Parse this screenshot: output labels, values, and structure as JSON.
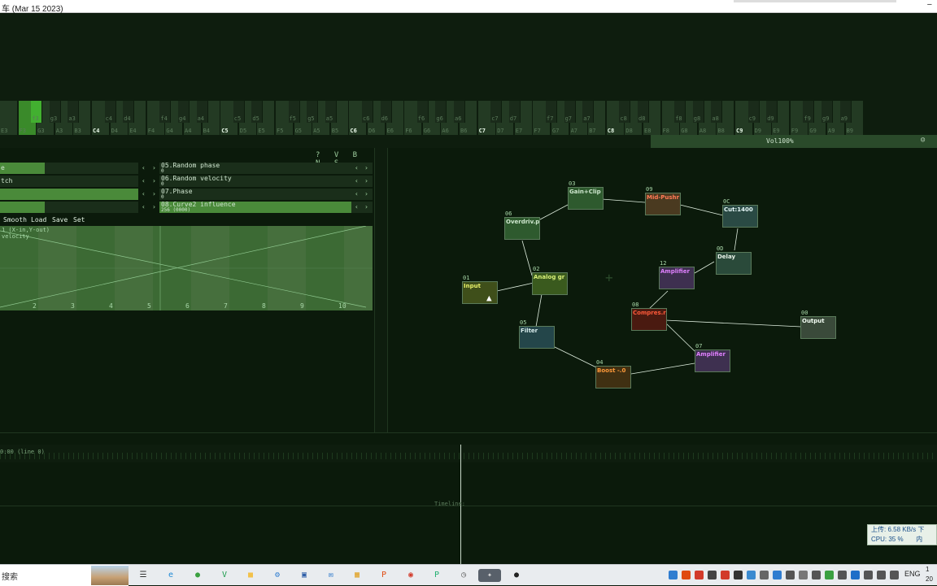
{
  "window": {
    "title": "车 (Mar 15 2023)",
    "close": "−"
  },
  "keyboard": {
    "whites": [
      {
        "label": "E3"
      },
      {
        "label": "F3",
        "hl": true
      },
      {
        "label": "G3"
      },
      {
        "label": "A3"
      },
      {
        "label": "B3"
      },
      {
        "label": "C4",
        "oct": true
      },
      {
        "label": "D4"
      },
      {
        "label": "E4"
      },
      {
        "label": "F4"
      },
      {
        "label": "G4"
      },
      {
        "label": "A4"
      },
      {
        "label": "B4"
      },
      {
        "label": "C5",
        "oct": true
      },
      {
        "label": "D5"
      },
      {
        "label": "E5"
      },
      {
        "label": "F5"
      },
      {
        "label": "G5"
      },
      {
        "label": "A5"
      },
      {
        "label": "B5"
      },
      {
        "label": "C6",
        "oct": true
      },
      {
        "label": "D6"
      },
      {
        "label": "E6"
      },
      {
        "label": "F6"
      },
      {
        "label": "G6"
      },
      {
        "label": "A6"
      },
      {
        "label": "B6"
      },
      {
        "label": "C7",
        "oct": true
      },
      {
        "label": "D7"
      },
      {
        "label": "E7"
      },
      {
        "label": "F7"
      },
      {
        "label": "G7"
      },
      {
        "label": "A7"
      },
      {
        "label": "B7"
      },
      {
        "label": "C8",
        "oct": true
      },
      {
        "label": "D8"
      },
      {
        "label": "E8"
      },
      {
        "label": "F8"
      },
      {
        "label": "G8"
      },
      {
        "label": "A8"
      },
      {
        "label": "B8"
      },
      {
        "label": "C9",
        "oct": true
      },
      {
        "label": "D9"
      },
      {
        "label": "E9"
      },
      {
        "label": "F9"
      },
      {
        "label": "G9"
      },
      {
        "label": "A9"
      },
      {
        "label": "B9"
      }
    ],
    "blacks": [
      {
        "label": "f3",
        "hl": true
      },
      {
        "label": "g3"
      },
      {
        "label": "a3"
      },
      {
        "label": "c4"
      },
      {
        "label": "d4"
      },
      {
        "label": "f4"
      },
      {
        "label": "g4"
      },
      {
        "label": "a4"
      },
      {
        "label": "c5"
      },
      {
        "label": "d5"
      },
      {
        "label": "f5"
      },
      {
        "label": "g5"
      },
      {
        "label": "a5"
      },
      {
        "label": "c6"
      },
      {
        "label": "d6"
      },
      {
        "label": "f6"
      },
      {
        "label": "g6"
      },
      {
        "label": "a6"
      },
      {
        "label": "c7"
      },
      {
        "label": "d7"
      },
      {
        "label": "f7"
      },
      {
        "label": "g7"
      },
      {
        "label": "a7"
      },
      {
        "label": "c8"
      },
      {
        "label": "d8"
      },
      {
        "label": "f8"
      },
      {
        "label": "g8"
      },
      {
        "label": "a8"
      },
      {
        "label": "c9"
      },
      {
        "label": "d9"
      },
      {
        "label": "f9"
      },
      {
        "label": "g9"
      },
      {
        "label": "a9"
      }
    ]
  },
  "volume": {
    "label": "Vol100%",
    "icon": "person-icon"
  },
  "panel": {
    "icons": "? V B N S",
    "controls_left": [
      {
        "label": "e",
        "level": 0.12
      },
      {
        "label": "tch",
        "level": 0.0
      },
      {
        "label": "",
        "level": 0.37
      },
      {
        "label": "",
        "level": 0.12
      }
    ],
    "controls_right": [
      {
        "name": "05.Random phase",
        "value": "0"
      },
      {
        "name": "06.Random velocity",
        "value": "0"
      },
      {
        "name": "07.Phase",
        "value": "0"
      },
      {
        "name": "08.Curve2 influence",
        "value": "256 (0000)"
      }
    ],
    "curve_buttons": [
      "Smooth",
      "Load",
      "Save",
      "Set"
    ],
    "graph_label_1": "1 (X-in,Y-out)",
    "graph_label_2": "velocity",
    "ticks": [
      "2",
      "3",
      "4",
      "5",
      "6",
      "7",
      "8",
      "9",
      "10"
    ]
  },
  "modules": [
    {
      "id": "01",
      "name": "Input",
      "bg": "#3f4f1a",
      "fg": "#e8f26a"
    },
    {
      "id": "02",
      "name": "Analog gr",
      "bg": "#3a5a1e",
      "fg": "#d8f078"
    },
    {
      "id": "03",
      "name": "Gain+Clip",
      "bg": "#2e5a2e",
      "fg": "#cfe8cf"
    },
    {
      "id": "06",
      "name": "Overdriv.p",
      "bg": "#2e5a2e",
      "fg": "#cfe8cf"
    },
    {
      "id": "09",
      "name": "Mid-Pushr",
      "bg": "#4a3a20",
      "fg": "#ff7a55"
    },
    {
      "id": "0C",
      "name": "Cut:1400",
      "bg": "#2a4a44",
      "fg": "#e6f8f8"
    },
    {
      "id": "0D",
      "name": "Delay",
      "bg": "#2a4a3a",
      "fg": "#e8f2e8"
    },
    {
      "id": "12",
      "name": "Amplifier",
      "bg": "#3e3050",
      "fg": "#e080ff"
    },
    {
      "id": "08",
      "name": "Compres.r",
      "bg": "#4a1a10",
      "fg": "#ff5a3a"
    },
    {
      "id": "05",
      "name": "Filter",
      "bg": "#24464a",
      "fg": "#d8ecec"
    },
    {
      "id": "04",
      "name": "Boost -.0",
      "bg": "#403012",
      "fg": "#ff9a3a"
    },
    {
      "id": "07",
      "name": "Amplifier",
      "bg": "#3e3050",
      "fg": "#e080ff"
    },
    {
      "id": "00",
      "name": "Output",
      "bg": "#3a4a3a",
      "fg": "#f4fff4"
    }
  ],
  "timeline": {
    "position": "0:00 (line 0)",
    "label": "Timeline:"
  },
  "network": {
    "up": "上传: 6.58 KB/s",
    "cpu": "CPU: 35 %",
    "down": "下",
    "mem": "内"
  },
  "taskbar": {
    "search": "搜索",
    "icons": [
      {
        "name": "task-view-icon",
        "glyph": "☰",
        "color": "#333"
      },
      {
        "name": "edge-icon",
        "glyph": "e",
        "color": "#1f8ad6"
      },
      {
        "name": "app-green-icon",
        "glyph": "●",
        "color": "#3aa040"
      },
      {
        "name": "vim-icon",
        "glyph": "V",
        "color": "#1f9d4f"
      },
      {
        "name": "folder-icon",
        "glyph": "■",
        "color": "#f2c14a"
      },
      {
        "name": "settings-icon",
        "glyph": "⚙",
        "color": "#2f7dd0"
      },
      {
        "name": "calendar-icon",
        "glyph": "▣",
        "color": "#2f5fa8"
      },
      {
        "name": "mail-icon",
        "glyph": "✉",
        "color": "#1e6fc8"
      },
      {
        "name": "store-icon",
        "glyph": "▦",
        "color": "#e0a020"
      },
      {
        "name": "search-tool-icon",
        "glyph": "P",
        "color": "#e04a10"
      },
      {
        "name": "chrome-icon",
        "glyph": "◉",
        "color": "#d23a2a"
      },
      {
        "name": "pycharm-icon",
        "glyph": "P",
        "color": "#20b070"
      },
      {
        "name": "clock-app-icon",
        "glyph": "◷",
        "color": "#666"
      },
      {
        "name": "sunvox-icon",
        "glyph": "✦",
        "color": "#ddd"
      },
      {
        "name": "record-icon",
        "glyph": "●",
        "color": "#222"
      }
    ],
    "lang": "ENG",
    "time": "1",
    "date": "20"
  }
}
